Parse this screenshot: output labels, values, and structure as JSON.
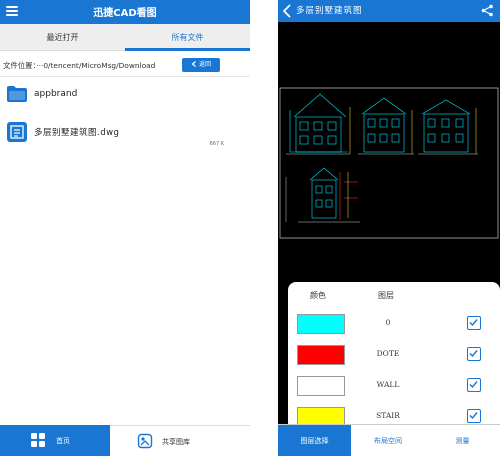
{
  "left": {
    "header": {
      "title": "迅捷CAD看图"
    },
    "tabs": [
      {
        "label": "最近打开"
      },
      {
        "label": "所有文件"
      }
    ],
    "path": {
      "label": "文件位置：",
      "value": "···0/tencent/MicroMsg/Download",
      "back_label": "返回"
    },
    "files": [
      {
        "name": "appbrand",
        "icon": "folder-icon"
      },
      {
        "name": "多层别墅建筑图.dwg",
        "size": "667 K",
        "icon": "dwg-file-icon"
      }
    ],
    "bottom_nav": [
      {
        "label": "首页",
        "icon": "grid-icon"
      },
      {
        "label": "共享图库",
        "icon": "share-gallery-icon"
      }
    ]
  },
  "right": {
    "header": {
      "title": "多层别墅建筑图"
    },
    "layer_panel": {
      "headers": {
        "color": "颜色",
        "layer": "图层"
      },
      "layers": [
        {
          "color": "#00ffff",
          "name": "0",
          "checked": true
        },
        {
          "color": "#ff0000",
          "name": "DOTE",
          "checked": true
        },
        {
          "color": "#ffffff",
          "name": "WALL",
          "checked": true
        },
        {
          "color": "#ffff00",
          "name": "STAIR",
          "checked": true
        }
      ]
    },
    "bottom_nav": [
      {
        "label": "图层选择"
      },
      {
        "label": "布局空间"
      },
      {
        "label": "测量"
      }
    ]
  },
  "colors": {
    "accent": "#1976d2",
    "canvas": "#000000"
  }
}
